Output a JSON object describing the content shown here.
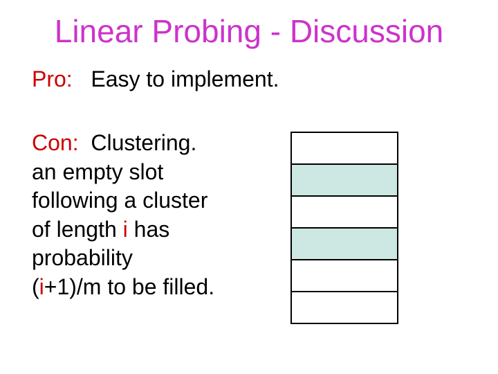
{
  "title": "Linear Probing - Discussion",
  "pro": {
    "label": "Pro:",
    "text": "Easy to implement."
  },
  "con": {
    "label": "Con:",
    "line1_rest": "Clustering.",
    "line2": "an empty slot",
    "line3": "following a cluster",
    "line4_a": "of length ",
    "line4_i": "i",
    "line4_b": " has",
    "line5": "probability",
    "line6_a": "(",
    "line6_i": "i",
    "line6_b": "+1)/m to be filled."
  },
  "table": {
    "rows": 6,
    "filled_indices": [
      1,
      3
    ]
  }
}
